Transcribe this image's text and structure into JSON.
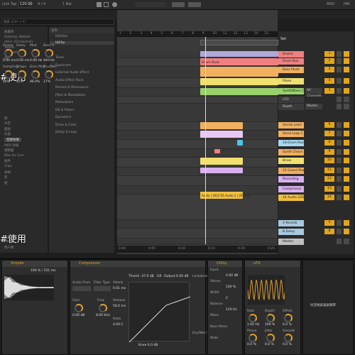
{
  "topbar": {
    "items": [
      "Link",
      "Tap",
      "120.00",
      "4 / 4",
      "1 Bar"
    ],
    "right": [
      "MIDI",
      "HW"
    ]
  },
  "browser": {
    "search_placeholder": "搜索 (Ctrl + F)",
    "left_items": [
      "收藏夹",
      "Dubstep Wobble",
      "other (Orchestral)",
      "Trends",
      "Bass 4/4",
      "Alt",
      "",
      "",
      "",
      "",
      "",
      "",
      "",
      "",
      "",
      "",
      "库",
      "声音",
      "鼓组",
      "乐器",
      "音频效果",
      "MIDI 效果",
      "调制器",
      "Max for Live",
      "插件",
      "Clips",
      "采样",
      "宏",
      "组",
      "",
      "",
      "",
      "",
      "",
      "",
      "",
      "",
      "",
      "位置",
      "Packs",
      "用户库"
    ],
    "right_header": "名称",
    "right_items": [
      "Utilities",
      "Utility",
      "Tuner",
      "Spectrum",
      "External Audio Effect",
      "Audio Effect Rack",
      "Reverb & Resonance",
      "Pitch & Modulation",
      "Modulators",
      "EQ & Filters",
      "Dynamics",
      "Drive & Color",
      "Delay & Loop"
    ]
  },
  "overlay": {
    "top_left": "#使用",
    "bottom_left": "#使用",
    "wm_center": "抖音搜索喜剧钢琴",
    "wm_right": "抖音搜索喜剧钢琴"
  },
  "arrangement": {
    "ruler": [
      "1",
      "2",
      "3",
      "4",
      "5",
      "6",
      "7",
      "8",
      "9",
      "10",
      "11",
      "12",
      "13",
      "14",
      "15"
    ],
    "clip_label": "Drum Rack",
    "audio_clip_label": "Audio | 2022-05 Audio 2 | 2022-05",
    "timeline": [
      "0:00",
      "0:05",
      "0:10",
      "0:15",
      "0:20",
      "0:25"
    ]
  },
  "tracks": [
    {
      "name": "Drums",
      "color": "#f08080",
      "num": "1"
    },
    {
      "name": "Drum Bus",
      "color": "#f08080",
      "num": "2"
    },
    {
      "name": "Bass Pluck",
      "color": "#f0b060",
      "num": "3"
    },
    {
      "name": "Piano",
      "color": "#f0e070",
      "num": "4"
    },
    {
      "name": "SynthWave C2",
      "color": "#9ad26a",
      "num": "5"
    },
    {
      "name": "LFO",
      "color": "#3a3a3a",
      "num": ""
    },
    {
      "name": "Depth",
      "color": "#3a3a3a",
      "num": ""
    },
    {
      "name": "Vocals Lead",
      "color": "#f0b060",
      "num": "6"
    },
    {
      "name": "Vocal Loop C",
      "color": "#f0b060",
      "num": "7"
    },
    {
      "name": "18 Drum Rack",
      "color": "#a8d8f0",
      "num": "8"
    },
    {
      "name": "Synth Chord",
      "color": "#f0b060",
      "num": "9"
    },
    {
      "name": "Brass",
      "color": "#f0e070",
      "num": "10"
    },
    {
      "name": "22 Grand Piano",
      "color": "#f0b060",
      "num": "11"
    },
    {
      "name": "Recording",
      "color": "#d8b0f0",
      "num": "12"
    },
    {
      "name": "Compressor",
      "color": "#d8b0f0",
      "num": "13"
    },
    {
      "name": "24 Audio 22D",
      "color": "#f0c040",
      "num": "14"
    }
  ],
  "returns": [
    {
      "name": "A Reverb",
      "color": "#a8c8e0",
      "num": "A"
    },
    {
      "name": "B Delay",
      "color": "#a8c8e0",
      "num": "B"
    },
    {
      "name": "Master",
      "color": "#c0c0c0",
      "num": ""
    }
  ],
  "mixer_header": "Set",
  "mixer_controls": {
    "input": "All Channels",
    "master": "Master"
  },
  "devices": {
    "sampler": {
      "title": "Simpler",
      "labels": [
        "Freeze",
        "Delay",
        "Mod",
        "Bass X",
        "Sampling",
        "Shape",
        "Bass Mod",
        "Dry/Wet"
      ],
      "values": [
        "0.00 ms",
        "0.00 ms",
        "0.00 Hz",
        "440 Hz",
        "46%",
        "41%",
        "46.0%",
        "17%"
      ],
      "readout": "100 % / 331 ms"
    },
    "compressor": {
      "title": "Compressor",
      "labels": [
        "Audio From",
        "Filter Type",
        "Gain",
        "Freq",
        "Attack",
        "Release",
        "Ratio"
      ],
      "values": [
        "0.00 dB",
        "8.00 kHz",
        "0.01 ms",
        "50.0 ms",
        "4.00:1"
      ],
      "thresh": "Thresh -37.0 dB",
      "gr": "GR",
      "out": "Output 0.00 dB",
      "knee": "Knee 6.0 dB",
      "lookahead": "Lookahead",
      "drywet": "Dry/Wet 100 %"
    },
    "utility": {
      "title": "Utility",
      "labels": [
        "Input",
        "Stereo",
        "Width",
        "Balance",
        "Mono",
        "Bass Mono",
        "Mute"
      ],
      "values": [
        "0.00 dB",
        "100 %",
        "C",
        "120 Hz"
      ]
    },
    "lfo": {
      "title": "LFO",
      "labels": [
        "Rate",
        "Depth",
        "Offset",
        "Phase",
        "Jitter",
        "Smooth"
      ],
      "values": [
        "1.00 Hz",
        "100 %",
        "0.0 %",
        "0.0 %",
        "0.0 %",
        "0.0 %"
      ]
    }
  }
}
